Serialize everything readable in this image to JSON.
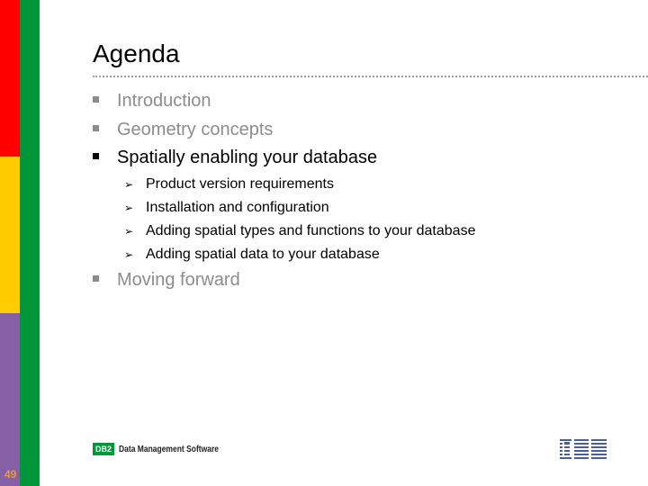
{
  "slide": {
    "title": "Agenda",
    "page_number": "49",
    "colors": {
      "red": "#ff0000",
      "yellow": "#ffcc00",
      "purple": "#8660a6",
      "green": "#009639",
      "dim_text": "#8c8c8c"
    }
  },
  "agenda": {
    "items": [
      {
        "label": "Introduction",
        "state": "dim"
      },
      {
        "label": "Geometry concepts",
        "state": "dim"
      },
      {
        "label": "Spatially enabling your database",
        "state": "active",
        "subitems": [
          "Product version requirements",
          "Installation and configuration",
          "Adding spatial types and functions to your database",
          "Adding spatial data to your database"
        ]
      },
      {
        "label": "Moving forward",
        "state": "dim"
      }
    ],
    "bullet_icon": "square-bullet-icon",
    "sub_bullet_icon": "arrow-bullet-icon",
    "sub_bullet_glyph": "➢"
  },
  "footer": {
    "db2_badge": "DB2",
    "product_name": "Data Management Software",
    "logo": "IBM"
  }
}
